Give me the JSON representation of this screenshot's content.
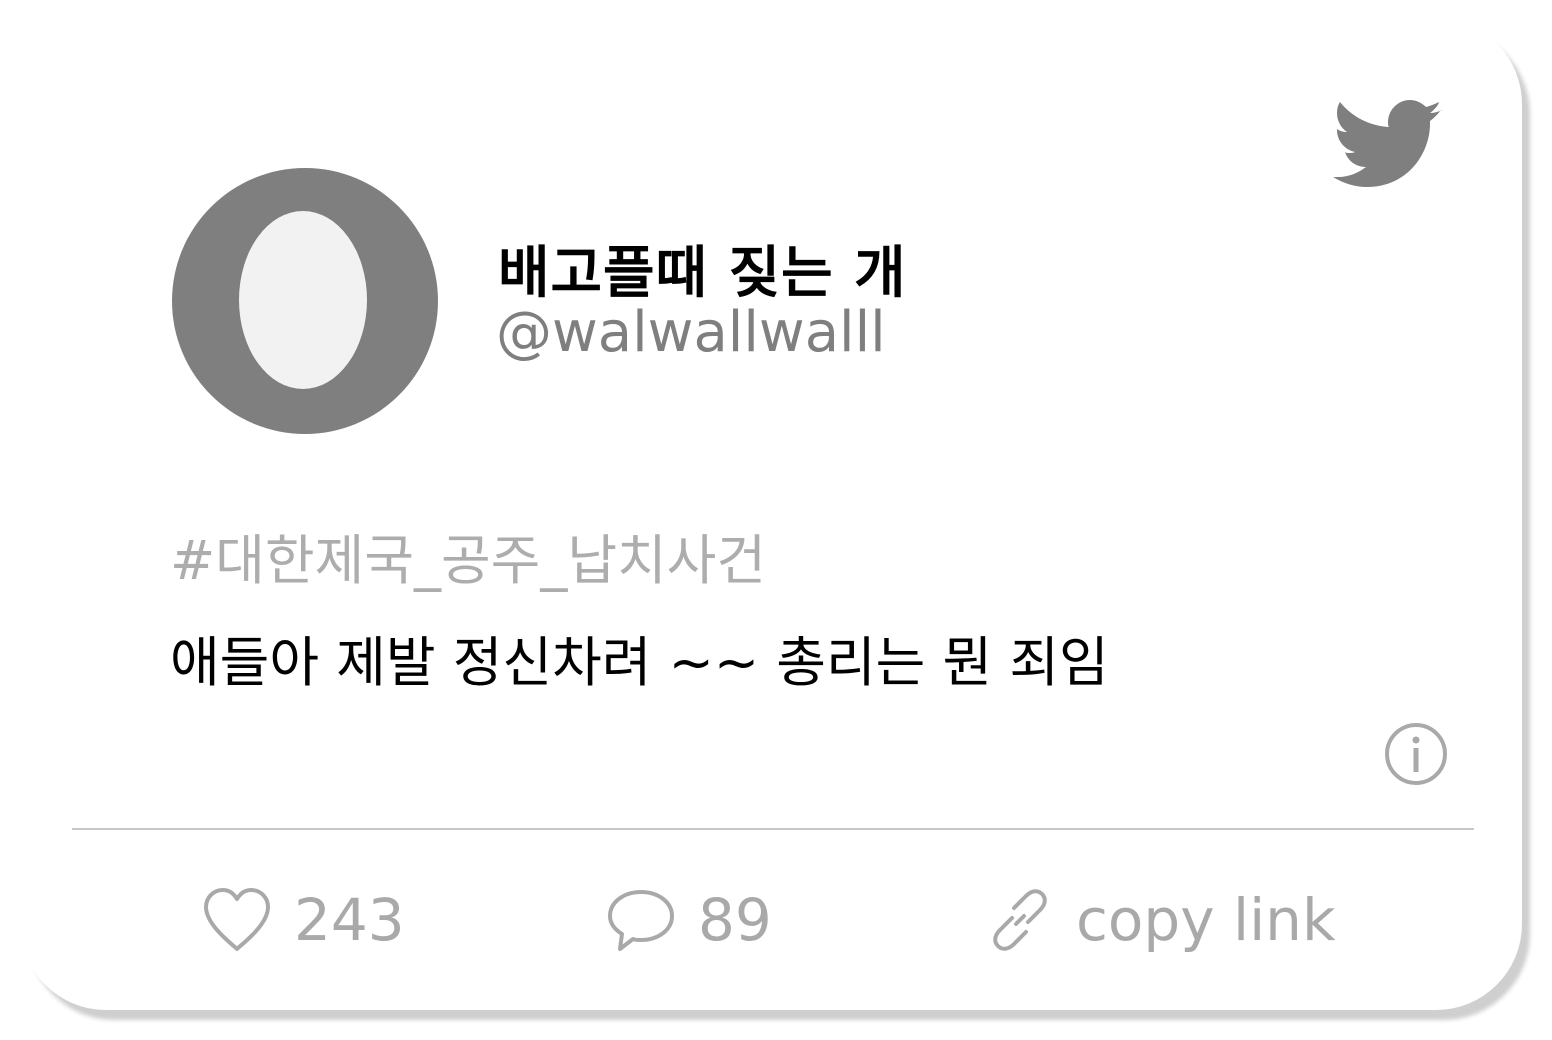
{
  "colors": {
    "card_background": "#ffffff",
    "icon_gray": "#7f7f7f",
    "muted_text": "#a9a9a9",
    "hashtag": "#adadad",
    "divider": "#c8c8c8"
  },
  "header": {
    "brand_icon": "twitter-bird-icon"
  },
  "profile": {
    "avatar_icon": "default-egg-avatar",
    "display_name": "배고플때 짖는 개",
    "handle": "@walwallwalll"
  },
  "tweet": {
    "hashtag": "#대한제국_공주_납치사건",
    "text": "애들아 제발 정신차려 ~~ 총리는 뭔 죄임",
    "info_icon": "info-icon"
  },
  "actions": {
    "likes": {
      "icon": "heart-icon",
      "count": "243"
    },
    "replies": {
      "icon": "speech-bubble-icon",
      "count": "89"
    },
    "copy_link": {
      "icon": "link-icon",
      "label": "copy link"
    }
  }
}
